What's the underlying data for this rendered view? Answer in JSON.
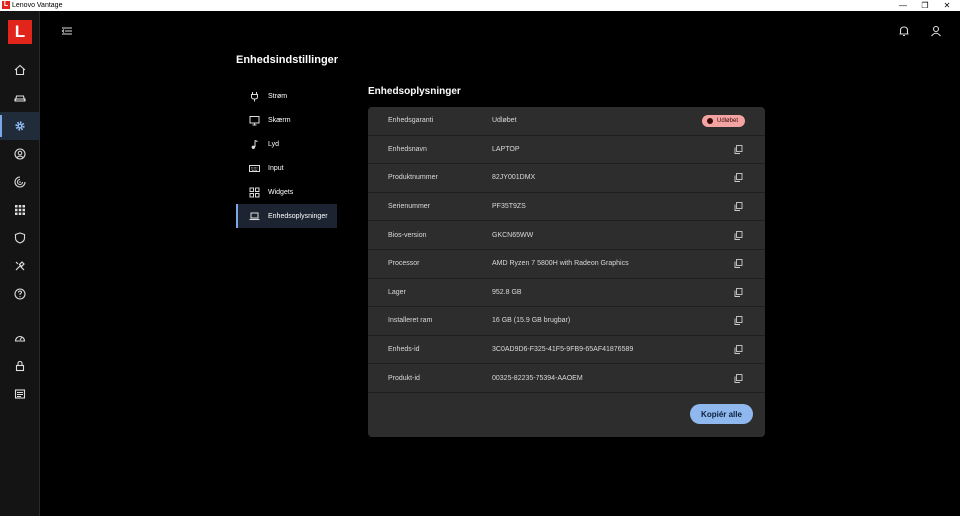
{
  "window": {
    "title": "Lenovo Vantage",
    "logo_letter": "L",
    "minimize": "—",
    "restore": "❐",
    "close": "✕"
  },
  "rail": {
    "brand_letter": "L",
    "items": [
      {
        "icon": "home-icon"
      },
      {
        "icon": "gaming-icon"
      },
      {
        "icon": "settings-icon",
        "active": true
      },
      {
        "icon": "account-icon"
      },
      {
        "icon": "hardware-icon"
      },
      {
        "icon": "apps-icon"
      },
      {
        "icon": "security-icon"
      },
      {
        "icon": "tools-icon"
      },
      {
        "icon": "help-icon"
      },
      {
        "icon": "dashboard-icon"
      },
      {
        "icon": "lock-icon"
      },
      {
        "icon": "news-icon"
      }
    ]
  },
  "header": {
    "page_title": "Enhedsindstillinger"
  },
  "subnav": {
    "items": [
      {
        "label": "Strøm",
        "icon": "power-icon"
      },
      {
        "label": "Skærm",
        "icon": "monitor-icon"
      },
      {
        "label": "Lyd",
        "icon": "music-note-icon"
      },
      {
        "label": "Input",
        "icon": "keyboard-icon"
      },
      {
        "label": "Widgets",
        "icon": "widgets-icon"
      },
      {
        "label": "Enhedsoplysninger",
        "icon": "laptop-icon",
        "active": true
      }
    ]
  },
  "section": {
    "title": "Enhedsoplysninger",
    "rows": [
      {
        "key": "Enhedsgaranti",
        "value": "Udløbet",
        "badge": "Udløbet"
      },
      {
        "key": "Enhedsnavn",
        "value": "LAPTOP"
      },
      {
        "key": "Produktnummer",
        "value": "82JY001DMX"
      },
      {
        "key": "Serienummer",
        "value": "PF35T9ZS"
      },
      {
        "key": "Bios-version",
        "value": "GKCN65WW"
      },
      {
        "key": "Processor",
        "value": "AMD Ryzen 7 5800H with Radeon Graphics"
      },
      {
        "key": "Lager",
        "value": "952.8 GB"
      },
      {
        "key": "Installeret ram",
        "value": "16 GB (15.9 GB brugbar)"
      },
      {
        "key": "Enheds-id",
        "value": "3C0AD9D6-F325-41F5-9FB9-65AF41876589"
      },
      {
        "key": "Produkt-id",
        "value": "00325-82235-75394-AAOEM"
      }
    ],
    "copy_all_label": "Kopiér alle"
  },
  "colors": {
    "accent": "#7aa8e6",
    "brand": "#e1251b",
    "badge_bg": "#f4a3a3",
    "button_bg": "#8fb8ef",
    "card_bg": "#2d2d2d"
  }
}
